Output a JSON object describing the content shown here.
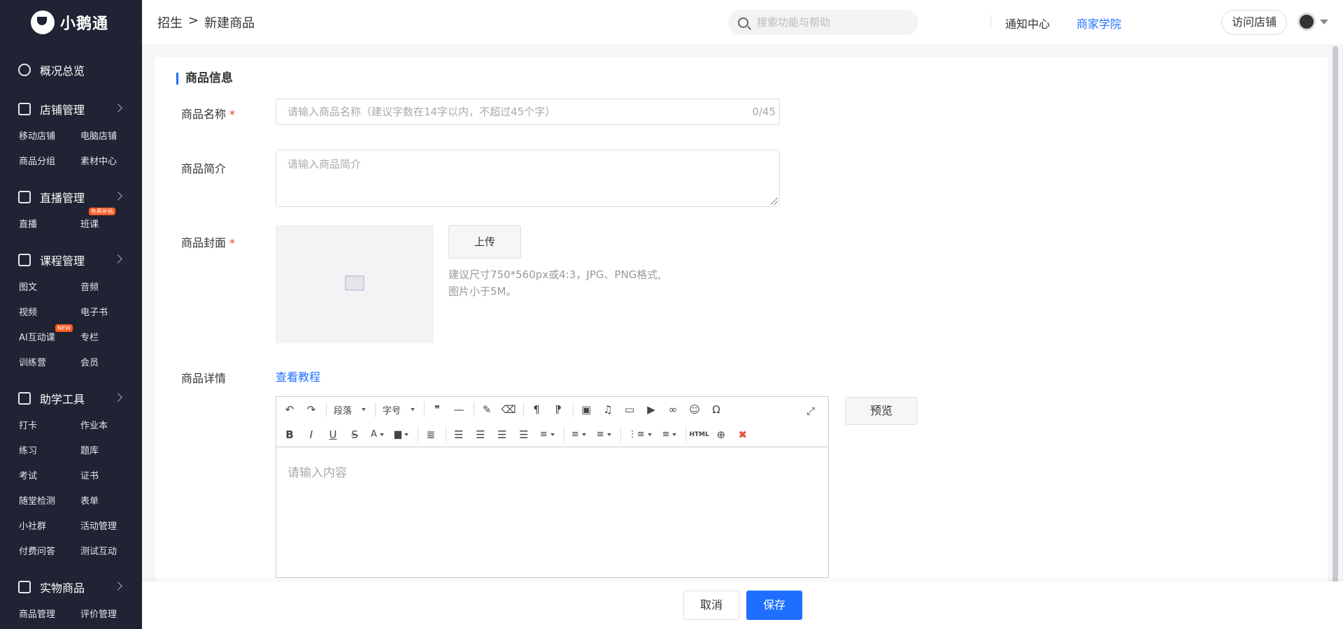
{
  "brand": {
    "logo_text": "小鹅通"
  },
  "sidebar": {
    "groups": [
      {
        "label": "概况总览",
        "items": []
      },
      {
        "label": "店铺管理",
        "items": [
          "移动店铺",
          "电脑店铺",
          "商品分组",
          "素材中心"
        ]
      },
      {
        "label": "直播管理",
        "items": [
          "直播",
          "班课"
        ],
        "badge": "免费补贴"
      },
      {
        "label": "课程管理",
        "items": [
          "图文",
          "音频",
          "视频",
          "电子书",
          "AI互动课",
          "专栏",
          "训练营",
          "会员"
        ],
        "badge": "NEW"
      },
      {
        "label": "助学工具",
        "items": [
          "打卡",
          "作业本",
          "练习",
          "题库",
          "考试",
          "证书",
          "随堂检测",
          "表单",
          "小社群",
          "活动管理",
          "付费问答",
          "测试互动"
        ]
      },
      {
        "label": "实物商品",
        "items": [
          "商品管理",
          "评价管理"
        ]
      }
    ]
  },
  "header": {
    "breadcrumb": [
      "招生",
      ">",
      "新建商品"
    ],
    "search_placeholder": "搜索功能与帮助",
    "academy": "商家学院",
    "notifications": "通知中心",
    "visit_store": "访问店铺"
  },
  "form": {
    "section_title": "商品信息",
    "name_label": "商品名称",
    "required_mark": "*",
    "name_placeholder": "请输入商品名称（建议字数在14字以内，不超过45个字）",
    "name_counter": "0/45",
    "intro_label": "商品简介",
    "intro_placeholder": "请输入商品简介",
    "cover_label": "商品封面",
    "upload_label": "上传",
    "cover_hint_line1": "建议尺寸750*560px或4:3，JPG、PNG格式,",
    "cover_hint_line2": "图片小于5M。",
    "detail_label": "商品详情",
    "tutorial_link": "查看教程",
    "editor_placeholder": "请输入内容",
    "preview_label": "预览",
    "toolbar": {
      "paragraph": "段落",
      "font_size": "字号",
      "html": "HTML"
    }
  },
  "footer": {
    "cancel": "取消",
    "save": "保存"
  },
  "colors": {
    "accent": "#1e6fff",
    "sidebar_bg": "#1f2333",
    "required": "#e43d33"
  }
}
